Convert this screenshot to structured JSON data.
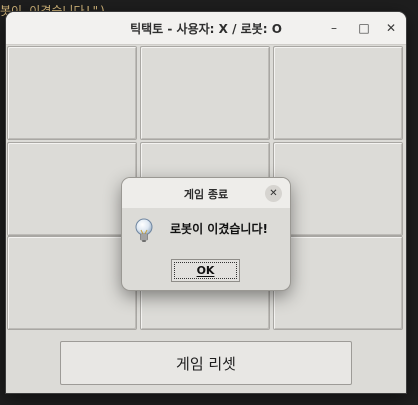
{
  "window": {
    "title": "틱택토 - 사용자: X / 로봇: O",
    "minimize_glyph": "–",
    "maximize_glyph": "□",
    "close_glyph": "✕"
  },
  "board": {
    "cells": [
      "",
      "",
      "",
      "",
      "",
      "",
      "",
      "",
      ""
    ]
  },
  "reset_button": {
    "label": "게임 리셋"
  },
  "dialog": {
    "title": "게임 종료",
    "close_glyph": "✕",
    "icon": "lightbulb-icon",
    "message": "로봇이 이겼습니다!",
    "ok_label": "OK"
  },
  "background": {
    "code_fragment": "봇이 이겼습니다!\")"
  }
}
